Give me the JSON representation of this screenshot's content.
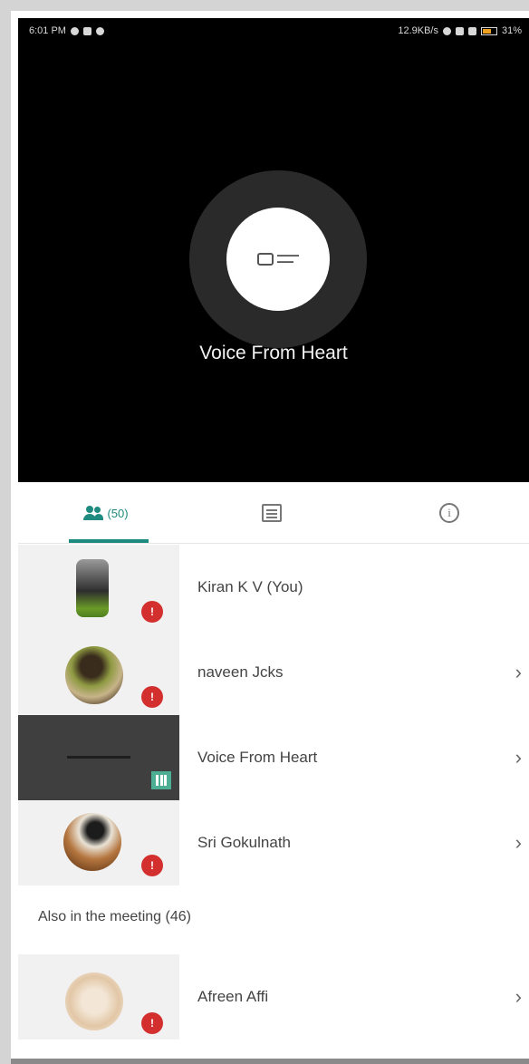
{
  "status_bar": {
    "time": "6:01 PM",
    "right_text": "12.9KB/s",
    "battery": "31%"
  },
  "stage": {
    "speaker_name": "Voice From Heart"
  },
  "tabs": {
    "participants_count": "(50)"
  },
  "participants": [
    {
      "name": "Kiran K V (You)",
      "muted": true,
      "chevron": false
    },
    {
      "name": "naveen Jcks",
      "muted": true,
      "chevron": true
    },
    {
      "name": "Voice From Heart",
      "muted": false,
      "speaking": true,
      "chevron": true
    },
    {
      "name": "Sri Gokulnath",
      "muted": true,
      "chevron": true
    }
  ],
  "also_in_meeting": {
    "label": "Also in the meeting (46)",
    "items": [
      {
        "name": "Afreen Affi",
        "muted": true,
        "chevron": true
      }
    ]
  },
  "icons": {
    "chevron": "›",
    "mute_badge": "!"
  },
  "colors": {
    "accent": "#1e8a80",
    "mute_red": "#d32f2f",
    "speaking_green": "#4caf93"
  }
}
